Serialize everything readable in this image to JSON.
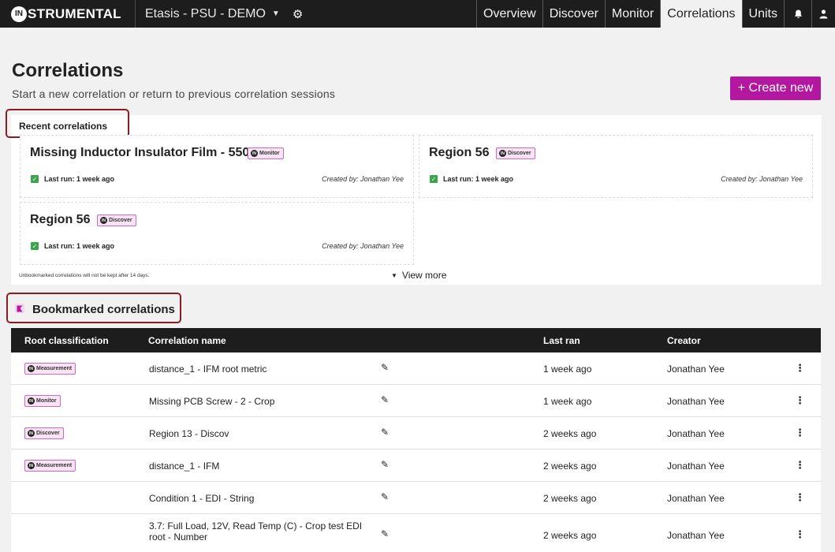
{
  "topbar": {
    "brand_mark": "IN",
    "brand_text": "STRUMENTAL",
    "project": "Etasis - PSU - DEMO",
    "tabs": [
      {
        "label": "Overview"
      },
      {
        "label": "Discover"
      },
      {
        "label": "Monitor"
      },
      {
        "label": "Correlations"
      },
      {
        "label": "Units"
      }
    ],
    "active_tab": "Correlations"
  },
  "header": {
    "title": "Correlations",
    "subtitle": "Start a new correlation or return to previous correlation sessions",
    "create_label": "+ Create new"
  },
  "recent": {
    "title": "Recent correlations",
    "cards": [
      {
        "name": "Missing Inductor Insulator Film - 550W",
        "tag": "Monitor",
        "last_run": "Last run: 1 week ago",
        "creator": "Created by: Jonathan Yee"
      },
      {
        "name": "Region 56",
        "tag": "Discover",
        "last_run": "Last run: 1 week ago",
        "creator": "Created by: Jonathan Yee"
      },
      {
        "name": "Region 56",
        "tag": "Discover",
        "last_run": "Last run: 1 week ago",
        "creator": "Created by: Jonathan Yee"
      }
    ],
    "retention_note": "Unbookmarked correlations will not be kept after 14 days.",
    "view_more": "View more"
  },
  "bookmarked": {
    "title": "Bookmarked correlations",
    "columns": [
      "Root classification",
      "Correlation name",
      "Last ran",
      "Creator"
    ],
    "rows": [
      {
        "tag": "Measurement",
        "name": "distance_1 - IFM root metric",
        "last_ran": "1 week ago",
        "creator": "Jonathan Yee"
      },
      {
        "tag": "Monitor",
        "name": "Missing PCB Screw - 2 - Crop",
        "last_ran": "1 week ago",
        "creator": "Jonathan Yee"
      },
      {
        "tag": "Discover",
        "name": "Region 13 - Discov",
        "last_ran": "2 weeks ago",
        "creator": "Jonathan Yee"
      },
      {
        "tag": "Measurement",
        "name": "distance_1 - IFM",
        "last_ran": "2 weeks ago",
        "creator": "Jonathan Yee"
      },
      {
        "tag": "",
        "name": "Condition 1 - EDI - String",
        "last_ran": "2 weeks ago",
        "creator": "Jonathan Yee"
      },
      {
        "tag": "",
        "name": "3.7: Full Load, 12V, Read Temp (C) - Crop test EDI root - Number",
        "last_ran": "2 weeks ago",
        "creator": "Jonathan Yee"
      }
    ]
  },
  "colors": {
    "accent": "#b4179f",
    "nav_bg": "#1d1d1d",
    "highlight_box": "#8b1c24",
    "check_green": "#3aa54a"
  },
  "icons": [
    "settings-gear-icon",
    "bell-icon",
    "user-icon",
    "caret-down-icon",
    "checkbox-icon",
    "bookmark-icon",
    "pencil-icon",
    "kebab-menu-icon"
  ]
}
